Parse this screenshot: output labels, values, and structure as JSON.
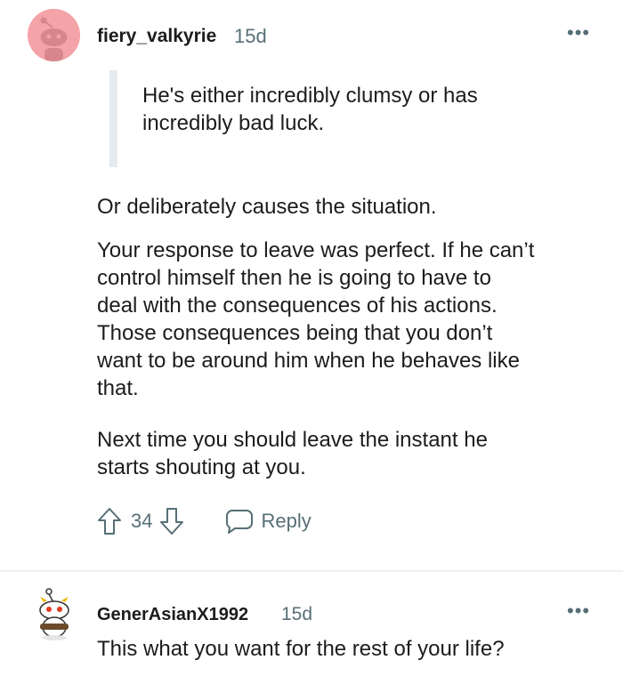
{
  "comments": [
    {
      "username": "fiery_valkyrie",
      "age": "15d",
      "more": "•••",
      "quote": [
        "He's either incredibly clumsy or has",
        "incredibly bad luck."
      ],
      "paragraphs": [
        [
          "Or deliberately causes the situation."
        ],
        [
          "Your response to leave was perfect. If he can’t",
          "control himself then he is going to have to",
          "deal with the consequences of his actions.",
          "Those consequences being that you don’t",
          "want to be around him when he behaves like",
          "that."
        ],
        [
          "Next time you should leave the instant he",
          "starts shouting at you."
        ]
      ],
      "votes": "34",
      "reply_label": "Reply",
      "avatar_color": "#f4a3a8"
    },
    {
      "username": "GenerAsianX1992",
      "age": "15d",
      "more": "•••",
      "text": "This what you want for the rest of your life?"
    }
  ],
  "colors": {
    "text": "#1c1c1c",
    "meta": "#576f76",
    "quote_bar": "#e5ebee",
    "divider": "#edeff1"
  }
}
